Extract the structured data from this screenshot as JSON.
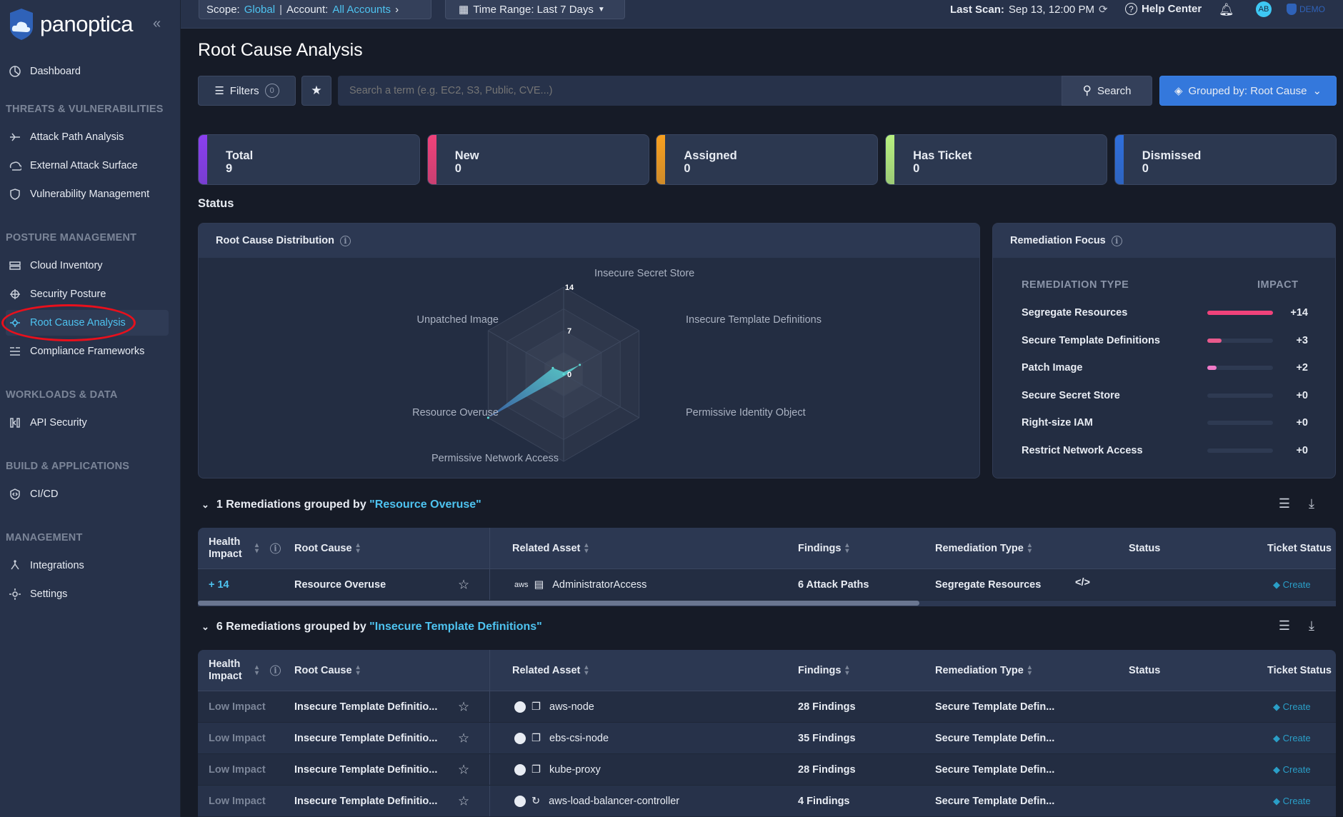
{
  "app": {
    "logo": "panoptica"
  },
  "sidebar": {
    "dashboard": "Dashboard",
    "sections": [
      {
        "title": "THREATS & VULNERABILITIES",
        "items": [
          "Attack Path Analysis",
          "External Attack Surface",
          "Vulnerability Management"
        ]
      },
      {
        "title": "POSTURE MANAGEMENT",
        "items": [
          "Cloud Inventory",
          "Security Posture",
          "Root Cause Analysis",
          "Compliance Frameworks"
        ]
      },
      {
        "title": "WORKLOADS & DATA",
        "items": [
          "API Security"
        ]
      },
      {
        "title": "BUILD & APPLICATIONS",
        "items": [
          "CI/CD"
        ]
      },
      {
        "title": "MANAGEMENT",
        "items": [
          "Integrations",
          "Settings"
        ]
      }
    ],
    "active": "Root Cause Analysis"
  },
  "topbar": {
    "scope_label": "Scope:",
    "scope_value": "Global",
    "account_label": "Account:",
    "account_value": "All Accounts",
    "time_range": "Time Range: Last 7 Days",
    "last_scan_label": "Last Scan:",
    "last_scan_value": "Sep 13, 12:00 PM",
    "help": "Help Center",
    "avatar": "AB",
    "demo": "DEMO"
  },
  "page": {
    "title": "Root Cause Analysis",
    "filters_label": "Filters",
    "filters_count": "0",
    "search_placeholder": "Search a term (e.g. EC2, S3, Public, CVE...)",
    "search_button": "Search",
    "grouped_by": "Grouped by: Root Cause"
  },
  "stats": [
    {
      "label": "Total",
      "value": "9",
      "color": "#8b3ff0"
    },
    {
      "label": "New",
      "value": "0",
      "color": "#f0427a"
    },
    {
      "label": "Assigned",
      "value": "0",
      "color": "#f8a020"
    },
    {
      "label": "Has Ticket",
      "value": "0",
      "color": "#b8f080"
    },
    {
      "label": "Dismissed",
      "value": "0",
      "color": "#2f6fdc"
    }
  ],
  "status_heading": "Status",
  "chart_data": {
    "type": "radar",
    "title": "Root Cause Distribution",
    "axes": [
      "Insecure Secret Store",
      "Insecure Template Definitions",
      "Permissive Identity Object",
      "Permissive Network Access",
      "Resource Overuse",
      "Unpatched Image"
    ],
    "values": [
      0,
      3,
      0,
      0,
      14,
      2
    ],
    "range": [
      0,
      14
    ],
    "tick_labels": [
      "0",
      "7",
      "14"
    ]
  },
  "remediation_focus": {
    "title": "Remediation Focus",
    "col_type": "REMEDIATION TYPE",
    "col_impact": "IMPACT",
    "rows": [
      {
        "type": "Segregate Resources",
        "impact": "+14",
        "value": 14,
        "color": "#f0427a"
      },
      {
        "type": "Secure Template Definitions",
        "impact": "+3",
        "value": 3,
        "color": "#e85a8c"
      },
      {
        "type": "Patch Image",
        "impact": "+2",
        "value": 2,
        "color": "#f07ac8"
      },
      {
        "type": "Secure Secret Store",
        "impact": "+0",
        "value": 0,
        "color": "#2e3a52"
      },
      {
        "type": "Right-size IAM",
        "impact": "+0",
        "value": 0,
        "color": "#2e3a52"
      },
      {
        "type": "Restrict Network Access",
        "impact": "+0",
        "value": 0,
        "color": "#2e3a52"
      }
    ]
  },
  "columns": {
    "health": "Health",
    "impact": "Impact",
    "root_cause": "Root Cause",
    "related_asset": "Related Asset",
    "findings": "Findings",
    "remediation_type": "Remediation Type",
    "status": "Status",
    "ticket_status": "Ticket Status"
  },
  "groups": [
    {
      "prefix": "1 Remediations grouped by",
      "name": "\"Resource Overuse\"",
      "rows": [
        {
          "health": "+ 14",
          "root_cause": "Resource Overuse",
          "provider": "aws",
          "asset": "AdministratorAccess",
          "findings": "6 Attack Paths",
          "remediation": "Segregate Resources",
          "ticket": "Create"
        }
      ]
    },
    {
      "prefix": "6 Remediations grouped by",
      "name": "\"Insecure Template Definitions\"",
      "rows": [
        {
          "health": "Low Impact",
          "root_cause": "Insecure Template Definitio...",
          "asset": "aws-node",
          "findings": "28 Findings",
          "remediation": "Secure Template Defin...",
          "ticket": "Create"
        },
        {
          "health": "Low Impact",
          "root_cause": "Insecure Template Definitio...",
          "asset": "ebs-csi-node",
          "findings": "35 Findings",
          "remediation": "Secure Template Defin...",
          "ticket": "Create"
        },
        {
          "health": "Low Impact",
          "root_cause": "Insecure Template Definitio...",
          "asset": "kube-proxy",
          "findings": "28 Findings",
          "remediation": "Secure Template Defin...",
          "ticket": "Create"
        },
        {
          "health": "Low Impact",
          "root_cause": "Insecure Template Definitio...",
          "asset": "aws-load-balancer-controller",
          "findings": "4 Findings",
          "remediation": "Secure Template Defin...",
          "ticket": "Create"
        }
      ]
    }
  ]
}
